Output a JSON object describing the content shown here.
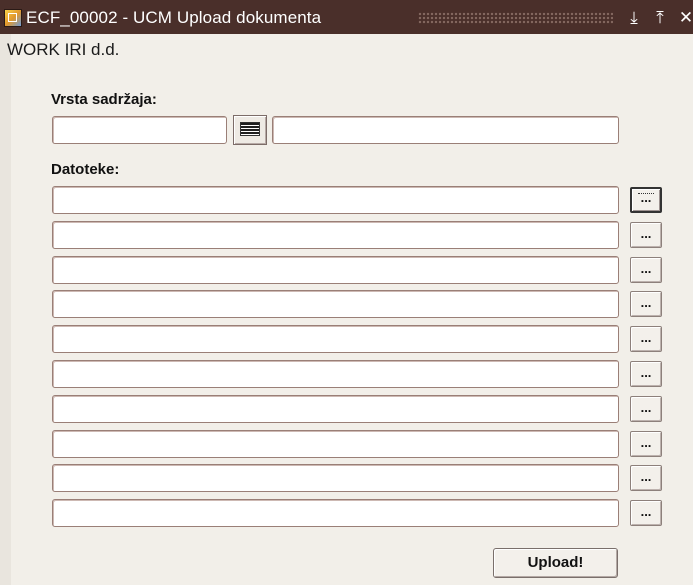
{
  "window": {
    "title": "ECF_00002 - UCM Upload dokumenta",
    "minimize_glyph": "⤓",
    "maximize_glyph": "⤒",
    "close_glyph": "✕",
    "app_icon": "forms-app-icon"
  },
  "company": "WORK IRI d.d.",
  "content_type": {
    "label": "Vrsta sadržaja:",
    "code_value": "",
    "description_value": "",
    "lov_icon": "list-of-values-icon"
  },
  "files": {
    "label": "Datoteke:",
    "browse_label": "...",
    "rows": [
      {
        "value": ""
      },
      {
        "value": ""
      },
      {
        "value": ""
      },
      {
        "value": ""
      },
      {
        "value": ""
      },
      {
        "value": ""
      },
      {
        "value": ""
      },
      {
        "value": ""
      },
      {
        "value": ""
      },
      {
        "value": ""
      }
    ]
  },
  "upload_button": "Upload!",
  "colors": {
    "titlebar": "#4a2f2a",
    "background": "#f2efe9",
    "field_border": "#9a7f77"
  }
}
